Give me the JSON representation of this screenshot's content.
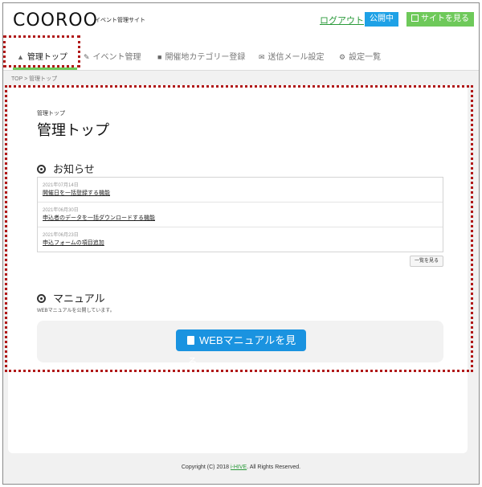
{
  "header": {
    "logo": "COOROO",
    "logo_sub": "イベント管理サイト",
    "logout": "ログアウト",
    "status_badge": "公開中",
    "view_site": "サイトを見る"
  },
  "nav": {
    "items": [
      {
        "label": "管理トップ",
        "icon": "home-icon"
      },
      {
        "label": "イベント管理",
        "icon": "pencil-icon"
      },
      {
        "label": "開催地カテゴリー登録",
        "icon": "folder-icon"
      },
      {
        "label": "送信メール設定",
        "icon": "mail-icon"
      },
      {
        "label": "設定一覧",
        "icon": "gear-icon"
      }
    ]
  },
  "breadcrumb": "TOP > 管理トップ",
  "page": {
    "small_title": "管理トップ",
    "title": "管理トップ"
  },
  "news": {
    "heading": "お知らせ",
    "items": [
      {
        "date": "2021年07月14日",
        "title": "開催日を一括登録する機能"
      },
      {
        "date": "2021年06月30日",
        "title": "申込者のデータを一括ダウンロードする機能"
      },
      {
        "date": "2021年06月23日",
        "title": "申込フォームの項目追加"
      }
    ],
    "list_button": "一覧を見る"
  },
  "manual": {
    "heading": "マニュアル",
    "description": "WEBマニュアルを公開しています。",
    "button": "WEBマニュアルを見る"
  },
  "footer": {
    "text_before": "Copyright (C) 2018 ",
    "link": "i-HIVE",
    "text_after": ". All Rights Reserved."
  },
  "colors": {
    "accent_green": "#6ec95a",
    "accent_blue": "#1a93e0",
    "highlight_red": "#b01717"
  }
}
